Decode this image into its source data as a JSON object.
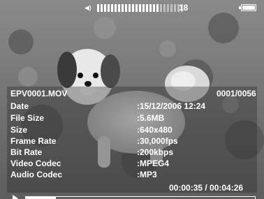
{
  "status": {
    "volume_level": 18,
    "volume_fraction": 0.72,
    "battery": "full"
  },
  "file": {
    "name": "EPV0001.MOV",
    "counter": "0001/0056"
  },
  "info": [
    {
      "label": "Date",
      "value": ":15/12/2006  12:24"
    },
    {
      "label": "File Size",
      "value": ":5.6MB"
    },
    {
      "label": "Size",
      "value": ":640x480"
    },
    {
      "label": "Frame Rate",
      "value": ":30,000fps"
    },
    {
      "label": "Bit Rate",
      "value": ":200kbps"
    },
    {
      "label": "Video Codec",
      "value": ":MPEG4"
    },
    {
      "label": "Audio Codec",
      "value": ":MP3"
    }
  ],
  "playback": {
    "time": "00:00:35 / 00:04:26",
    "progress": 0.13
  },
  "icons": {
    "volume": "speaker-icon",
    "play": "play-icon",
    "battery": "battery-icon"
  }
}
